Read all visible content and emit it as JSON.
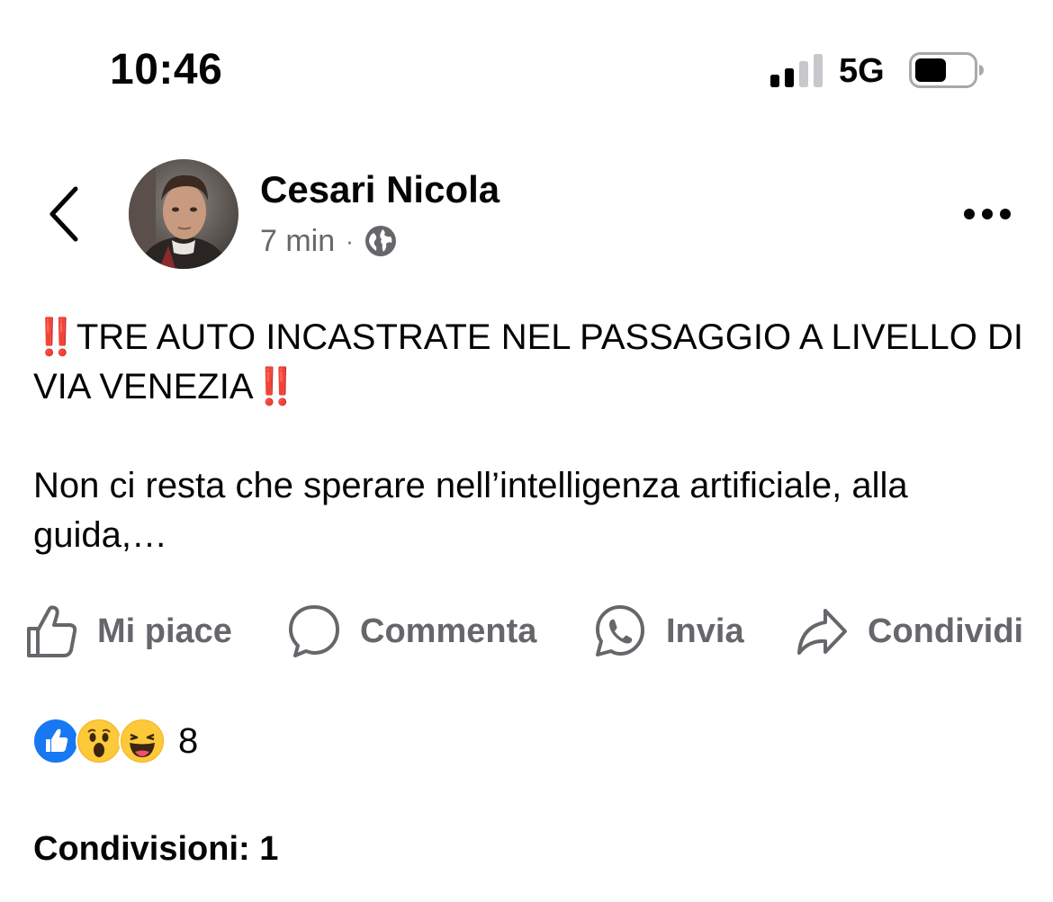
{
  "status_bar": {
    "time": "10:46",
    "network": "5G",
    "signal_bars_active": 2,
    "signal_bars_total": 4
  },
  "header": {
    "author_name": "Cesari Nicola",
    "timestamp": "7 min",
    "separator": "·",
    "audience_icon": "globe-icon",
    "back_icon": "chevron-left-icon",
    "more_icon": "more-horizontal-icon"
  },
  "post": {
    "line1_mark_start": "‼️",
    "line1_text": "TRE AUTO INCASTRATE NEL PASSAGGIO A LIVELLO DI VIA VENEZIA",
    "line1_mark_end": "‼️",
    "line2_text": "Non ci resta che sperare nell’intelligenza artificiale, alla guida,…"
  },
  "actions": {
    "like_label": "Mi piace",
    "comment_label": "Commenta",
    "send_label": "Invia",
    "share_label": "Condividi"
  },
  "reactions": {
    "icons": [
      "like-reaction-icon",
      "wow-reaction-icon",
      "haha-reaction-icon"
    ],
    "count": "8"
  },
  "shares_label": "Condivisioni: 1",
  "colors": {
    "text": "#050505",
    "secondary_text": "#65676b",
    "like_blue": "#1877f2",
    "reaction_yellow": "#f7b125",
    "double_exclamation_red": "#e0245e"
  }
}
